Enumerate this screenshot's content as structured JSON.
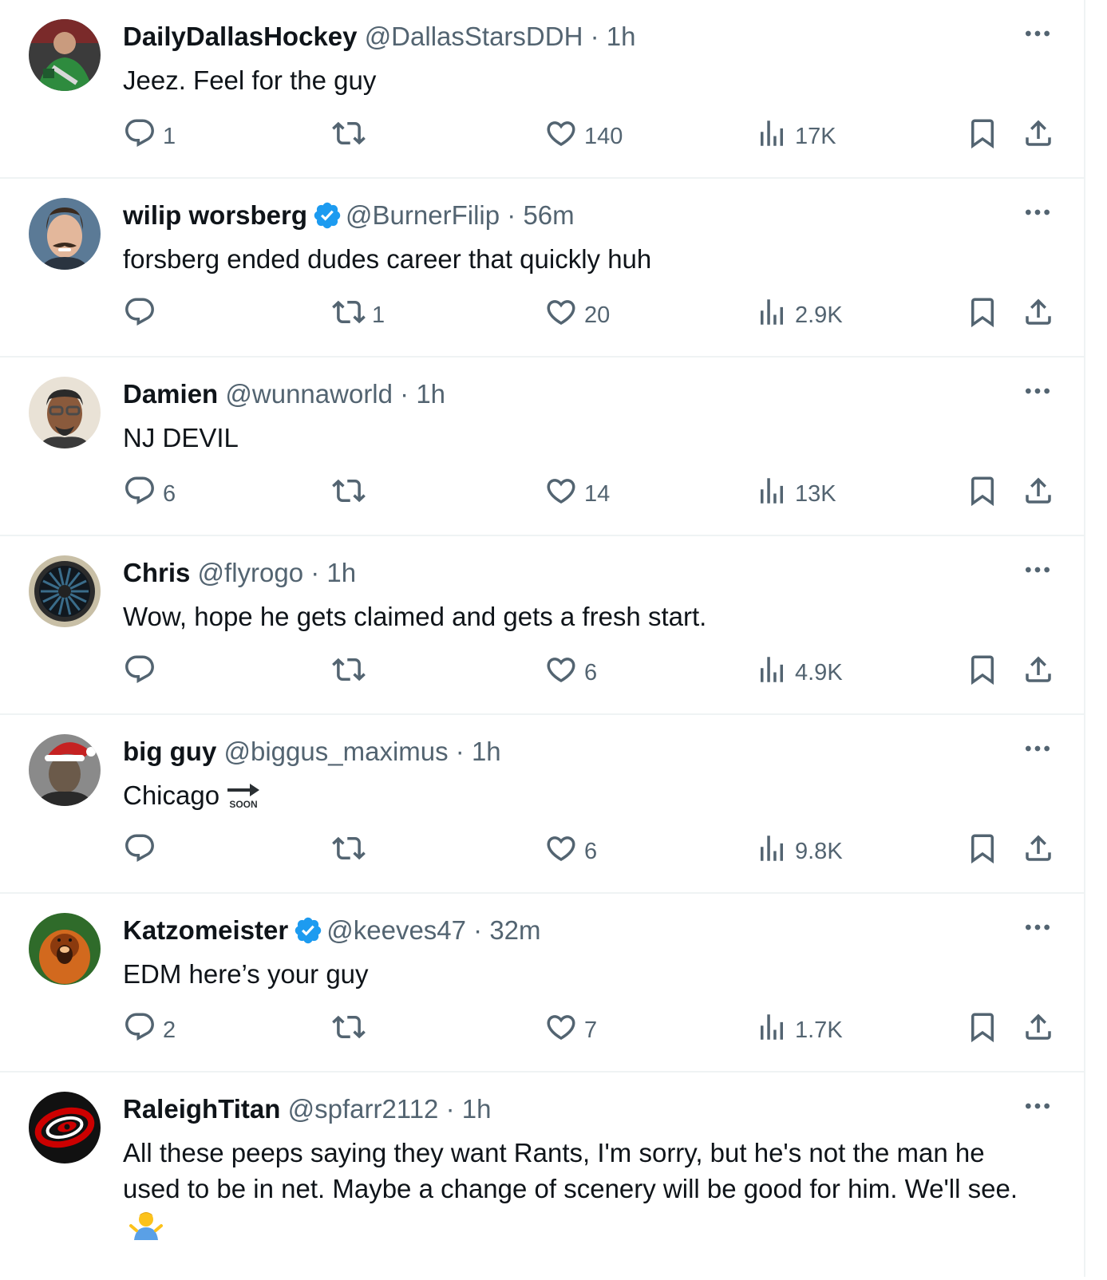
{
  "tweets": [
    {
      "name": "DailyDallasHockey",
      "verified": false,
      "handle": "@DallasStarsDDH",
      "time": "1h",
      "text": "Jeez. Feel for the guy",
      "replies": "1",
      "retweets": "",
      "likes": "140",
      "views": "17K",
      "avatar": {
        "icon": "avatar-hockey-fan",
        "colors": [
          "#1f5a2e",
          "#2e8b3e",
          "#d8d8d8",
          "#7a2a2a"
        ]
      }
    },
    {
      "name": "wilip worsberg",
      "verified": true,
      "handle": "@BurnerFilip",
      "time": "56m",
      "text": "forsberg ended dudes career that quickly huh",
      "replies": "",
      "retweets": "1",
      "likes": "20",
      "views": "2.9K",
      "avatar": {
        "icon": "avatar-mustache-man",
        "colors": [
          "#5b7a96",
          "#e3b79b",
          "#3a2a1e",
          "#ffffff"
        ]
      }
    },
    {
      "name": "Damien",
      "verified": false,
      "handle": "@wunnaworld",
      "time": "1h",
      "text": "NJ DEVIL",
      "replies": "6",
      "retweets": "",
      "likes": "14",
      "views": "13K",
      "avatar": {
        "icon": "avatar-man-glasses",
        "colors": [
          "#e9e2d6",
          "#8a5a3c",
          "#2a2a2a",
          "#4a4a4a"
        ]
      }
    },
    {
      "name": "Chris",
      "verified": false,
      "handle": "@flyrogo",
      "time": "1h",
      "text": "Wow, hope he gets claimed and gets a fresh start.",
      "replies": "",
      "retweets": "",
      "likes": "6",
      "views": "4.9K",
      "avatar": {
        "icon": "avatar-jet-engine",
        "colors": [
          "#c8bfa6",
          "#2c2c2c",
          "#11181f",
          "#3a6c8a"
        ]
      }
    },
    {
      "name": "big guy",
      "verified": false,
      "handle": "@biggus_maximus",
      "time": "1h",
      "text": "Chicago",
      "soon_emoji": "SOON",
      "replies": "",
      "retweets": "",
      "likes": "6",
      "views": "9.8K",
      "avatar": {
        "icon": "avatar-santa-hat-man",
        "colors": [
          "#c52222",
          "#ffffff",
          "#6b5a4a",
          "#2a2a2a"
        ]
      }
    },
    {
      "name": "Katzomeister",
      "verified": true,
      "handle": "@keeves47",
      "time": "32m",
      "text": "EDM here’s your guy",
      "replies": "2",
      "retweets": "",
      "likes": "7",
      "views": "1.7K",
      "avatar": {
        "icon": "avatar-orangutan",
        "colors": [
          "#2f6b2a",
          "#d2691e",
          "#8b3a0e",
          "#f5c08a"
        ]
      }
    },
    {
      "name": "RaleighTitan",
      "verified": false,
      "handle": "@spfarr2112",
      "time": "1h",
      "text": "All these peeps saying they want Rants, I'm sorry, but he's not the man he used to be in net. Maybe a change of scenery will be good for him. We'll see.",
      "emoji": "person-shrugging-emoji",
      "replies": "",
      "retweets": "",
      "likes": "",
      "views": "",
      "avatar": {
        "icon": "avatar-hurricanes-logo",
        "colors": [
          "#111111",
          "#cc0000",
          "#ffffff"
        ]
      }
    }
  ],
  "colors": {
    "text": "#0f1419",
    "secondary": "#536471",
    "verified": "#1d9bf0",
    "divider": "#eff3f4"
  },
  "icons": {
    "reply": "reply-icon",
    "retweet": "retweet-icon",
    "like": "heart-icon",
    "views": "views-icon",
    "bookmark": "bookmark-icon",
    "share": "share-icon",
    "more": "more-icon"
  }
}
